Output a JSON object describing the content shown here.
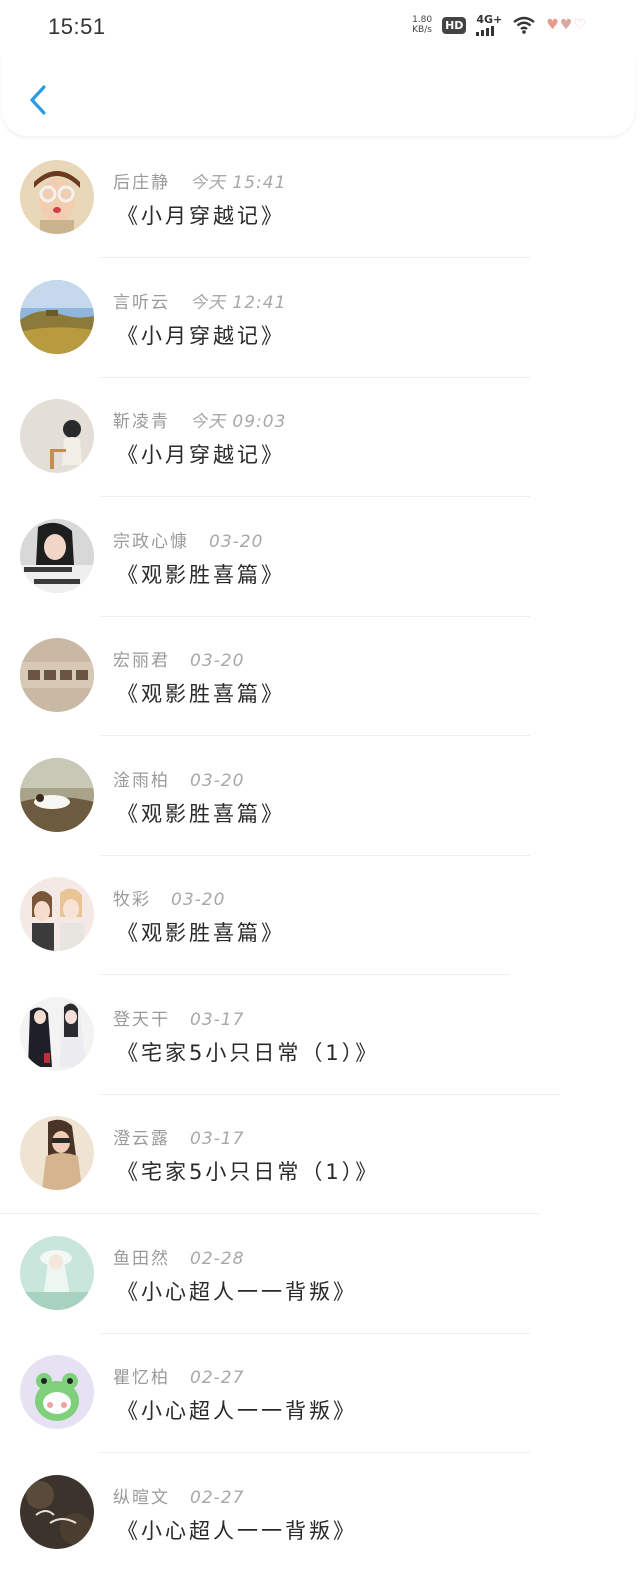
{
  "status_bar": {
    "time": "15:51",
    "net_speed_value": "1.80",
    "net_speed_unit": "KB/s",
    "hd": "HD",
    "signal": "4G+"
  },
  "nav": {
    "back_icon": "chevron-left-icon",
    "accent_color": "#2b9be8"
  },
  "messages": [
    {
      "name": "后庄静",
      "date": "今天 15:41",
      "title": "《小月穿越记》"
    },
    {
      "name": "言听云",
      "date": "今天 12:41",
      "title": "《小月穿越记》"
    },
    {
      "name": "靳凌青",
      "date": "今天 09:03",
      "title": "《小月穿越记》"
    },
    {
      "name": "宗政心慷",
      "date": "03-20",
      "title": "《观影胜喜篇》"
    },
    {
      "name": "宏丽君",
      "date": "03-20",
      "title": "《观影胜喜篇》"
    },
    {
      "name": "淦雨柏",
      "date": "03-20",
      "title": "《观影胜喜篇》"
    },
    {
      "name": "牧彩",
      "date": "03-20",
      "title": "《观影胜喜篇》"
    },
    {
      "name": "登天干",
      "date": "03-17",
      "title": "《宅家5小只日常（1）》"
    },
    {
      "name": "澄云露",
      "date": "03-17",
      "title": "《宅家5小只日常（1）》"
    },
    {
      "name": "鱼田然",
      "date": "02-28",
      "title": "《小心超人一一背叛》"
    },
    {
      "name": "瞿忆柏",
      "date": "02-27",
      "title": "《小心超人一一背叛》"
    },
    {
      "name": "纵暄文",
      "date": "02-27",
      "title": "《小心超人一一背叛》"
    }
  ]
}
